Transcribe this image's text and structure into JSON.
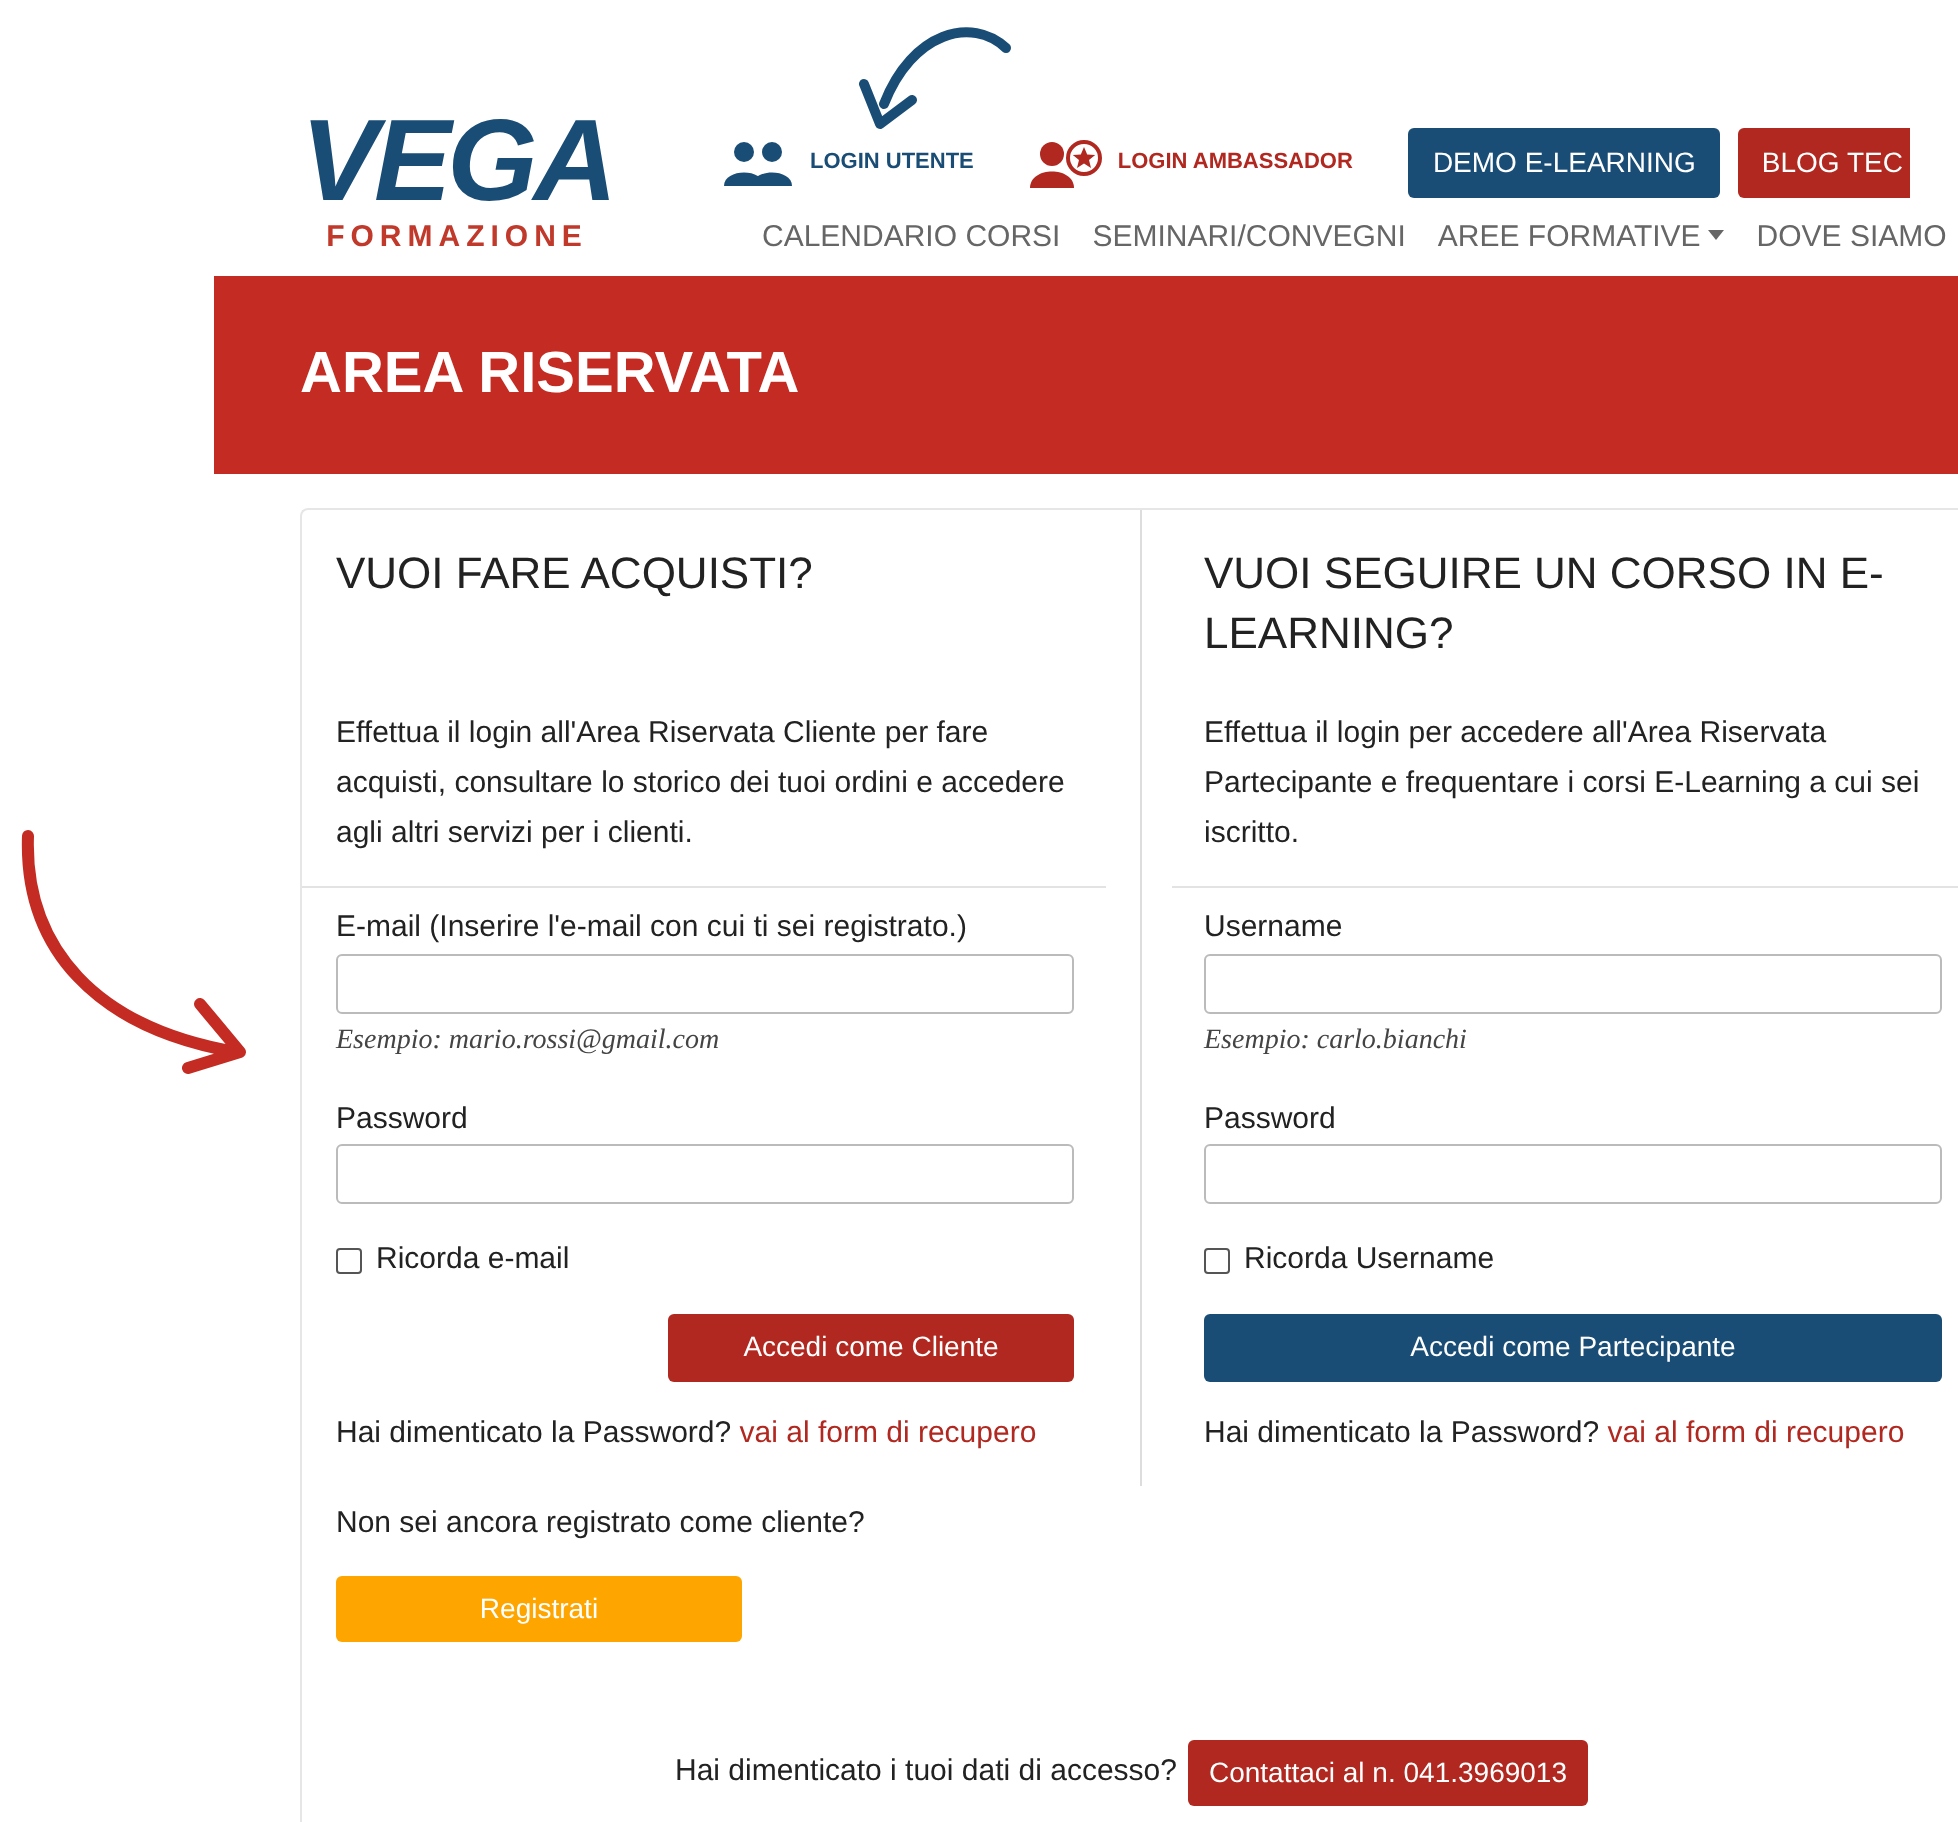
{
  "header": {
    "logo": {
      "title": "VEGA",
      "subtitle": "FORMAZIONE"
    },
    "top_links": [
      {
        "label": "LOGIN UTENTE",
        "kind": "users",
        "color": "#1a4d75"
      },
      {
        "label": "LOGIN AMBASSADOR",
        "kind": "ambassador",
        "color": "#b0281f"
      }
    ],
    "top_buttons": [
      {
        "label": "DEMO E-LEARNING",
        "color": "#1a4d75"
      },
      {
        "label": "BLOG TEC",
        "color": "#b0281f"
      }
    ],
    "nav": [
      {
        "label": "CALENDARIO CORSI",
        "dropdown": false
      },
      {
        "label": "SEMINARI/CONVEGNI",
        "dropdown": false
      },
      {
        "label": "AREE FORMATIVE",
        "dropdown": true
      },
      {
        "label": "DOVE SIAMO",
        "dropdown": false
      }
    ]
  },
  "banner": {
    "title": "AREA RISERVATA"
  },
  "panels": [
    {
      "title": "VUOI FARE ACQUISTI?",
      "description": "Effettua il login all'Area Riservata Cliente per fare acquisti, consultare lo storico dei tuoi ordini e accedere agli altri servizi per i clienti.",
      "fields": [
        {
          "label": "E-mail (Inserire l'e-mail con cui ti sei registrato.)",
          "hint": "Esempio: mario.rossi@gmail.com"
        },
        {
          "label": "Password"
        }
      ],
      "remember": {
        "label": "Ricorda e-mail",
        "checked": false
      },
      "submit": {
        "label": "Accedi come Cliente",
        "color": "#b0281f"
      },
      "forgot": {
        "text": "Hai dimenticato la Password?",
        "link": "vai al form di recupero"
      }
    },
    {
      "title": "VUOI SEGUIRE UN CORSO IN E-LEARNING?",
      "description": "Effettua il login per accedere all'Area Riservata Partecipante e frequentare i corsi E-Learning a cui sei iscritto.",
      "fields": [
        {
          "label": "Username",
          "hint": "Esempio: carlo.bianchi"
        },
        {
          "label": "Password"
        }
      ],
      "remember": {
        "label": "Ricorda Username",
        "checked": false
      },
      "submit": {
        "label": "Accedi come Partecipante",
        "color": "#1a4d75"
      },
      "forgot": {
        "text": "Hai dimenticato la Password?",
        "link": "vai al form di recupero"
      }
    }
  ],
  "register": {
    "text": "Non sei ancora registrato come cliente?",
    "button": "Registrati"
  },
  "contact": {
    "text": "Hai dimenticato i tuoi dati di accesso?",
    "button": "Contattaci al n. 041.3969013"
  }
}
